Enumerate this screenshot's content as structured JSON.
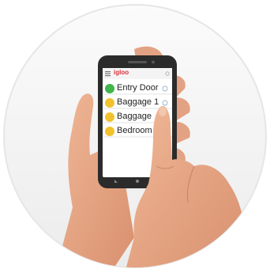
{
  "app": {
    "brand": "igloo",
    "menu_icon": "hamburger-menu-icon",
    "header_icon": "options-icon"
  },
  "locks": [
    {
      "label": "Entry Door",
      "status_color": "#3fb54a",
      "icon": "lock-status-icon",
      "action_icon": "info-icon"
    },
    {
      "label": "Baggage 1",
      "status_color": "#f2c22c",
      "icon": "lock-status-icon",
      "action_icon": "info-icon"
    },
    {
      "label": "Baggage",
      "status_color": "#f2c22c",
      "icon": "lock-status-icon",
      "action_icon": "info-icon"
    },
    {
      "label": "Bedroom",
      "status_color": "#f2c22c",
      "icon": "lock-status-icon",
      "action_icon": "info-icon"
    }
  ],
  "colors": {
    "brand": "#d8343d",
    "phone_body": "#2b2b2b",
    "skin": "#e8a888"
  }
}
